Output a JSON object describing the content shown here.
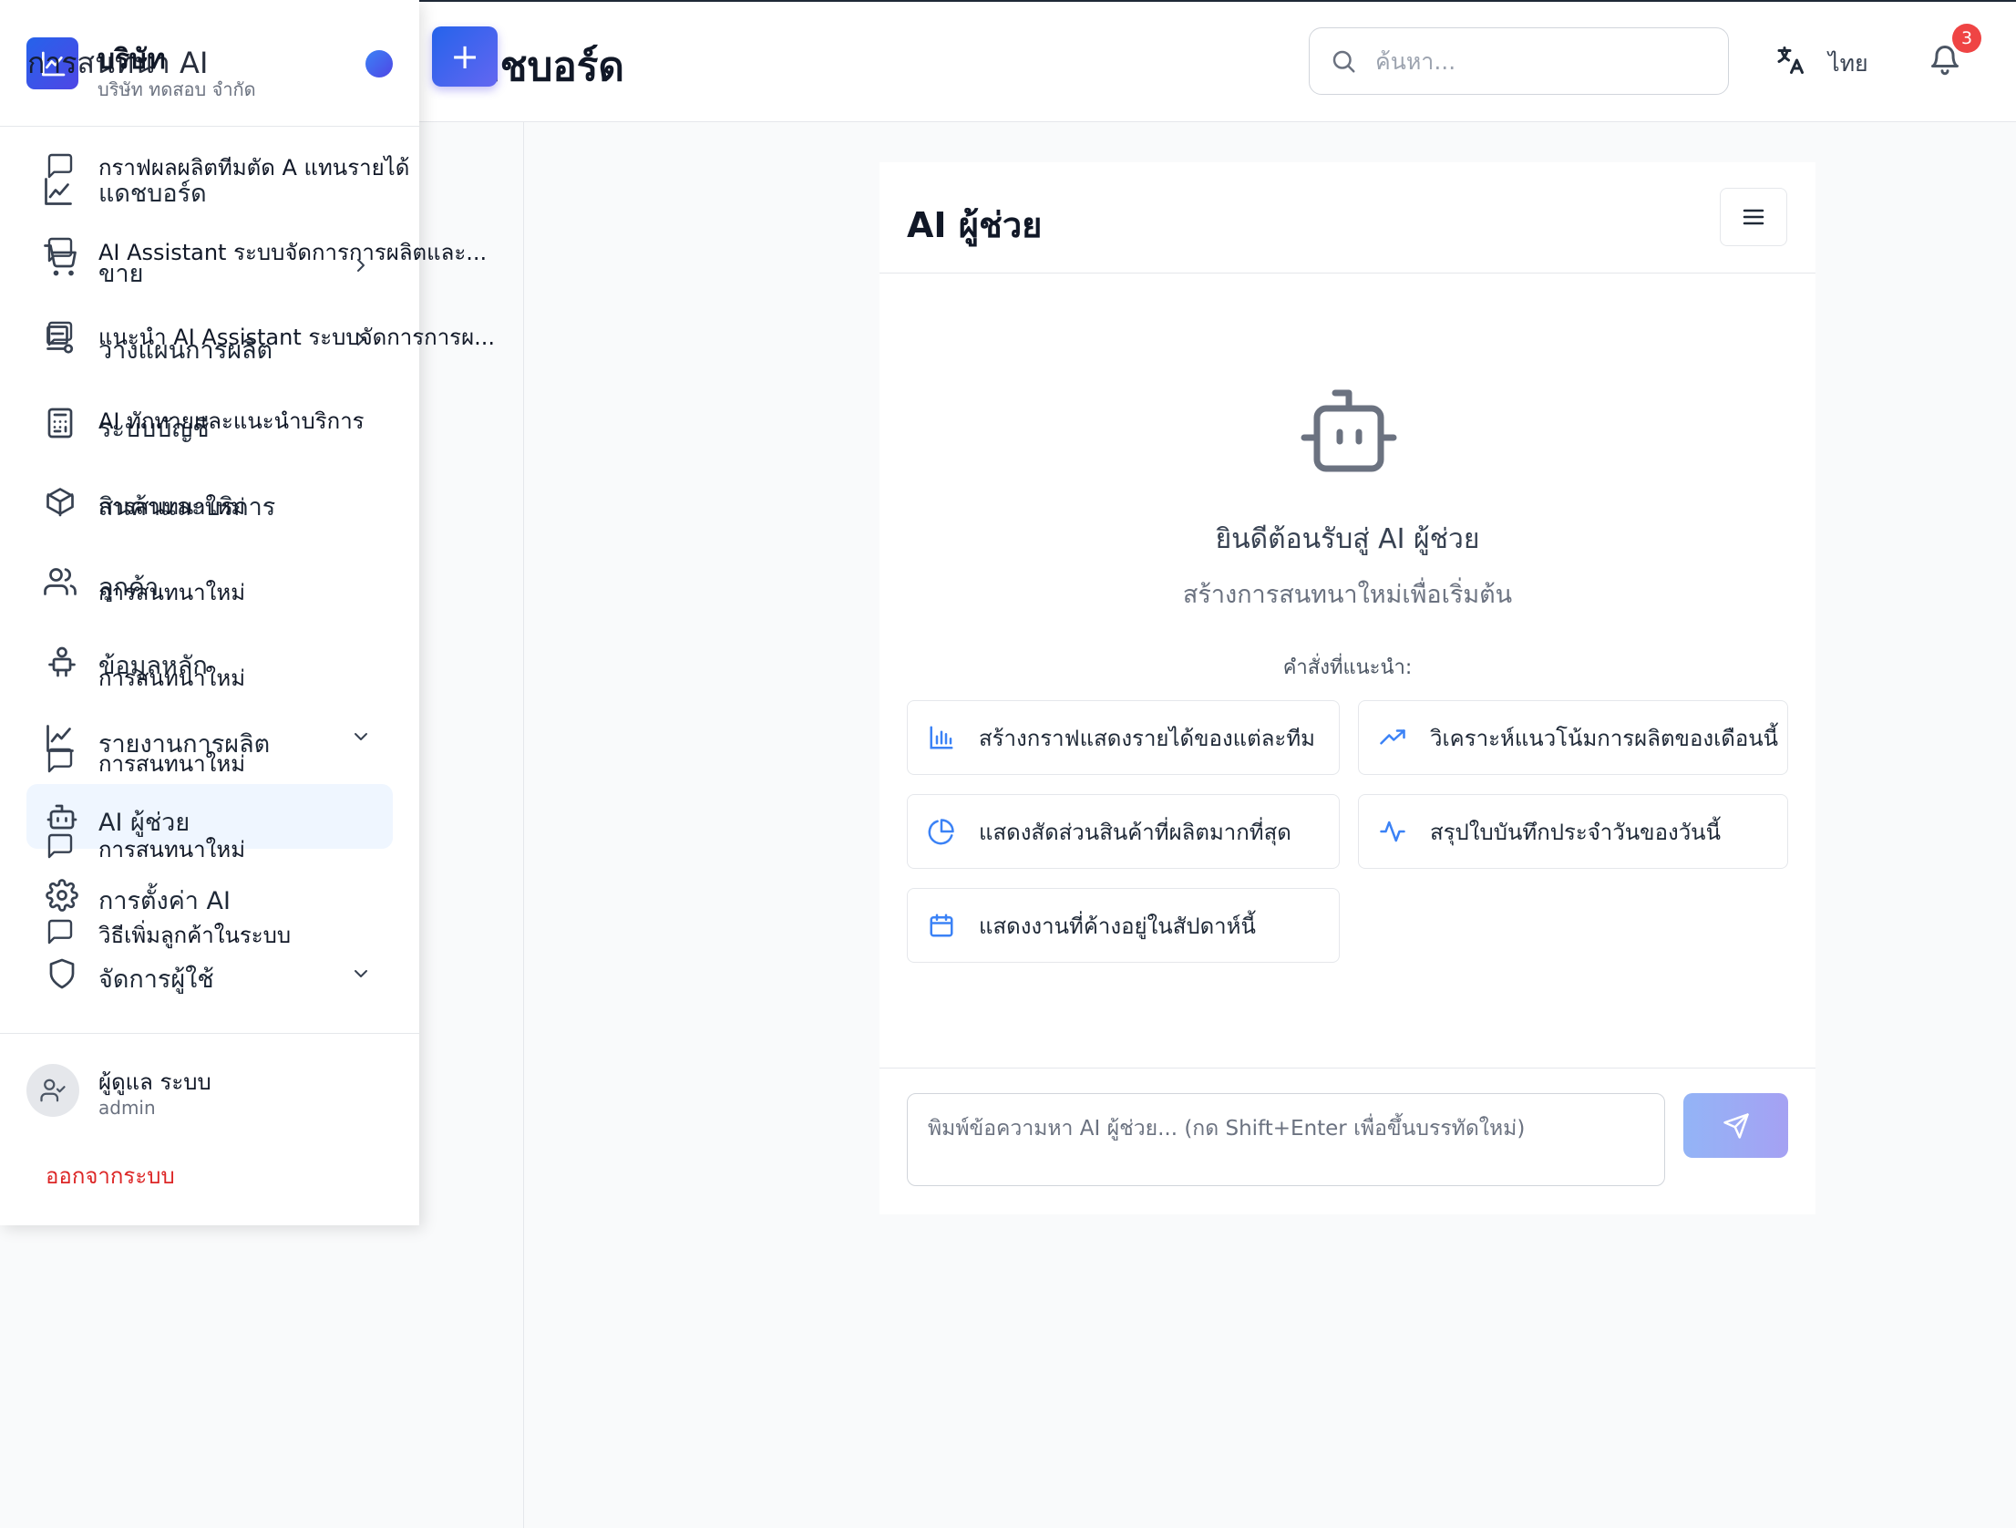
{
  "header": {
    "page_title": "แดชบอร์ด",
    "visible_page_title": "ดชบอร์ด",
    "search_placeholder": "ค้นหา...",
    "language": "ไทย",
    "notification_count": "3",
    "new_chat_symbol": "+"
  },
  "brand": {
    "name": "บริษัท",
    "overlay_title": "การสนทนา AI",
    "subtitle": "บริษัท ทดสอบ จำกัด"
  },
  "sidebar": {
    "nav": [
      {
        "label": "แดชบอร์ด",
        "icon": "chart-line-icon"
      },
      {
        "label": "ขาย",
        "icon": "cart-icon",
        "has_chevron": "right"
      },
      {
        "label": "วางแผนการผลิต",
        "icon": "plan-icon",
        "has_chevron": "right"
      },
      {
        "label": "ระบบบัญชี",
        "icon": "calculator-icon"
      },
      {
        "label": "สินค้าและบริการ",
        "icon": "box-icon"
      },
      {
        "label": "ลูกค้า",
        "icon": "users-icon"
      },
      {
        "label": "ข้อมูลหลัก",
        "icon": "factory-icon"
      },
      {
        "label": "รายงานการผลิต",
        "icon": "chart-line-icon",
        "has_chevron": "down"
      },
      {
        "label": "AI ผู้ช่วย",
        "icon": "robot-icon",
        "active": true
      },
      {
        "label": "การตั้งค่า AI",
        "icon": "gear-icon"
      },
      {
        "label": "จัดการผู้ใช้",
        "icon": "shield-icon",
        "has_chevron": "down"
      }
    ],
    "history": [
      "กราฟผลผลิตทีมตัด A แทนรายได้",
      "AI Assistant ระบบจัดการการผลิตและ...",
      "แนะนำ AI Assistant ระบบจัดการการผ...",
      "AI ทักทายและแนะนำบริการ",
      "การสนทนาใหม่",
      "การสนทนาใหม่",
      "การสนทนาใหม่",
      "การสนทนาใหม่",
      "การสนทนาใหม่",
      "วิธีเพิ่มลูกค้าในระบบ"
    ]
  },
  "user": {
    "name": "ผู้ดูแล ระบบ",
    "role": "admin",
    "logout": "ออกจากระบบ"
  },
  "chat": {
    "title": "AI ผู้ช่วย",
    "welcome_title": "ยินดีต้อนรับสู่ AI ผู้ช่วย",
    "welcome_subtitle": "สร้างการสนทนาใหม่เพื่อเริ่มต้น",
    "suggestions_label": "คำสั่งที่แนะนำ:",
    "suggestions": [
      {
        "label": "สร้างกราฟแสดงรายได้ของแต่ละทีม",
        "icon": "bar-chart-icon"
      },
      {
        "label": "วิเคราะห์แนวโน้มการผลิตของเดือนนี้",
        "icon": "trending-up-icon"
      },
      {
        "label": "แสดงสัดส่วนสินค้าที่ผลิตมากที่สุด",
        "icon": "pie-chart-icon"
      },
      {
        "label": "สรุปใบบันทึกประจำวันของวันนี้",
        "icon": "activity-icon"
      },
      {
        "label": "แสดงงานที่ค้างอยู่ในสัปดาห์นี้",
        "icon": "calendar-icon"
      }
    ],
    "input_placeholder": "พิมพ์ข้อความหา AI ผู้ช่วย... (กด Shift+Enter เพื่อขึ้นบรรทัดใหม่)"
  },
  "colors": {
    "accent": "#2563eb",
    "accent_secondary": "#4f46e5",
    "active_bg": "#eff6ff",
    "danger": "#dc2626",
    "badge": "#ef4444"
  }
}
